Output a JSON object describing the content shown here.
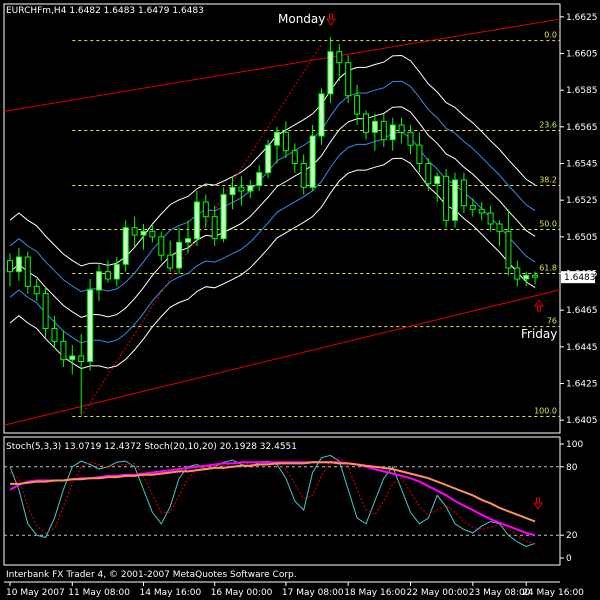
{
  "header": {
    "symbol": "EURCHFm,H4",
    "ohlc": "1.6482 1.6483 1.6479 1.6483"
  },
  "footer": {
    "copyright": "Interbank FX Trader 4, © 2001-2007 MetaQuotes Software Corp."
  },
  "colors": {
    "background": "#000000",
    "bull_candle": "#c8ffc8",
    "bear_candle": "#000000",
    "candle_outline": "#00ff00",
    "fib": "#e6e64a",
    "trend": "#e00000",
    "inner_band": "#2f8fe8",
    "outer_band": "#ffffff",
    "stoch_fast_main": "#4ac8c8",
    "stoch_fast_signal": "#e00000",
    "stoch_slow_main": "#ff00ff",
    "stoch_slow_signal": "#ff9060"
  },
  "chart_data": [
    {
      "type": "candlestick",
      "title": "",
      "price_axis": {
        "ylim": [
          1.6398,
          1.6632
        ],
        "ticks": [
          "1.6625",
          "1.6605",
          "1.6585",
          "1.6565",
          "1.6545",
          "1.6525",
          "1.6505",
          "1.6485",
          "1.6465",
          "1.6445",
          "1.6425",
          "1.6405"
        ],
        "current_price": "1.6483"
      },
      "time_axis": {
        "ticks": [
          "10 May 2007",
          "11 May 08:00",
          "14 May 16:00",
          "16 May 00:00",
          "17 May 08:00",
          "18 May 16:00",
          "22 May 00:00",
          "23 May 08:00",
          "24 May 16:00"
        ]
      },
      "candles": [
        [
          1.6492,
          1.6496,
          1.6478,
          1.6486
        ],
        [
          1.6486,
          1.6499,
          1.6481,
          1.6494
        ],
        [
          1.6494,
          1.6497,
          1.6474,
          1.6478
        ],
        [
          1.6478,
          1.6482,
          1.647,
          1.6474
        ],
        [
          1.6474,
          1.6478,
          1.645,
          1.6455
        ],
        [
          1.6455,
          1.6462,
          1.6444,
          1.6448
        ],
        [
          1.6448,
          1.6454,
          1.6434,
          1.6438
        ],
        [
          1.6438,
          1.6446,
          1.643,
          1.644
        ],
        [
          1.644,
          1.6452,
          1.6408,
          1.6437
        ],
        [
          1.6437,
          1.6482,
          1.6432,
          1.6476
        ],
        [
          1.6476,
          1.649,
          1.647,
          1.6486
        ],
        [
          1.6486,
          1.6492,
          1.648,
          1.6482
        ],
        [
          1.6482,
          1.6494,
          1.6478,
          1.649
        ],
        [
          1.649,
          1.6514,
          1.6486,
          1.651
        ],
        [
          1.651,
          1.6516,
          1.65,
          1.6506
        ],
        [
          1.6506,
          1.6512,
          1.6498,
          1.6508
        ],
        [
          1.6508,
          1.6512,
          1.6502,
          1.6505
        ],
        [
          1.6505,
          1.6508,
          1.6492,
          1.6495
        ],
        [
          1.6495,
          1.6503,
          1.6486,
          1.6488
        ],
        [
          1.6488,
          1.651,
          1.6485,
          1.6502
        ],
        [
          1.6502,
          1.6514,
          1.6496,
          1.6504
        ],
        [
          1.6504,
          1.653,
          1.65,
          1.6524
        ],
        [
          1.6524,
          1.6528,
          1.651,
          1.6516
        ],
        [
          1.6516,
          1.6522,
          1.65,
          1.6504
        ],
        [
          1.6504,
          1.6532,
          1.6502,
          1.6528
        ],
        [
          1.6528,
          1.6538,
          1.652,
          1.6532
        ],
        [
          1.6532,
          1.6538,
          1.6522,
          1.653
        ],
        [
          1.653,
          1.6536,
          1.6526,
          1.6533
        ],
        [
          1.6533,
          1.6544,
          1.653,
          1.654
        ],
        [
          1.654,
          1.6558,
          1.6537,
          1.6555
        ],
        [
          1.6555,
          1.6565,
          1.6545,
          1.6562
        ],
        [
          1.6562,
          1.6568,
          1.6548,
          1.6552
        ],
        [
          1.6552,
          1.6556,
          1.654,
          1.6545
        ],
        [
          1.6545,
          1.655,
          1.6528,
          1.6532
        ],
        [
          1.6532,
          1.6566,
          1.653,
          1.656
        ],
        [
          1.656,
          1.6586,
          1.6555,
          1.6583
        ],
        [
          1.6583,
          1.6614,
          1.6578,
          1.6606
        ],
        [
          1.6606,
          1.661,
          1.659,
          1.66
        ],
        [
          1.66,
          1.6604,
          1.6578,
          1.6582
        ],
        [
          1.6582,
          1.6588,
          1.6566,
          1.6572
        ],
        [
          1.6572,
          1.6574,
          1.6558,
          1.6562
        ],
        [
          1.6562,
          1.6572,
          1.6552,
          1.6568
        ],
        [
          1.6568,
          1.6572,
          1.6554,
          1.6558
        ],
        [
          1.6558,
          1.657,
          1.6552,
          1.6566
        ],
        [
          1.6566,
          1.657,
          1.6556,
          1.6562
        ],
        [
          1.6562,
          1.6566,
          1.655,
          1.6555
        ],
        [
          1.6555,
          1.6562,
          1.654,
          1.6545
        ],
        [
          1.6545,
          1.6548,
          1.653,
          1.6534
        ],
        [
          1.6534,
          1.654,
          1.6524,
          1.6538
        ],
        [
          1.6538,
          1.6542,
          1.651,
          1.6514
        ],
        [
          1.6514,
          1.654,
          1.651,
          1.6536
        ],
        [
          1.6536,
          1.654,
          1.6518,
          1.6522
        ],
        [
          1.6522,
          1.6526,
          1.6516,
          1.652
        ],
        [
          1.652,
          1.6524,
          1.6514,
          1.6518
        ],
        [
          1.6518,
          1.6522,
          1.6508,
          1.6512
        ],
        [
          1.6512,
          1.6514,
          1.65,
          1.6508
        ],
        [
          1.6508,
          1.652,
          1.6484,
          1.6488
        ],
        [
          1.6488,
          1.6492,
          1.6478,
          1.6482
        ],
        [
          1.6482,
          1.6486,
          1.6478,
          1.6484
        ],
        [
          1.6484,
          1.6486,
          1.6479,
          1.6483
        ]
      ],
      "overlays": {
        "fibonacci": [
          {
            "label": "0.0",
            "price": 1.6612
          },
          {
            "label": "23.6",
            "price": 1.6563
          },
          {
            "label": "38.2",
            "price": 1.6533
          },
          {
            "label": "50.0",
            "price": 1.6509
          },
          {
            "label": "61.8",
            "price": 1.6485
          },
          {
            "label": "76",
            "price": 1.6456
          },
          {
            "label": "100.0",
            "price": 1.6407
          }
        ],
        "upper_trendline": {
          "from": [
            0,
            1.6574
          ],
          "to": [
            72,
            1.6632
          ]
        },
        "lower_trendline": {
          "from": [
            0,
            1.6403
          ],
          "to": [
            60,
            1.6474
          ]
        },
        "dotted_trendline": {
          "from": [
            8,
            1.6407
          ],
          "to": [
            35,
            1.661
          ]
        }
      },
      "annotations": [
        {
          "text": "Monday",
          "marker": "down-arrow"
        },
        {
          "text": "Friday",
          "marker": "up-arrow"
        }
      ]
    },
    {
      "type": "line",
      "title": "",
      "indicator_header": "Stoch(5,3,3) 13.0719 12.4372  Stoch(20,10,20) 20.1928 32.4551",
      "ylim": [
        0,
        100
      ],
      "yticks": [
        100,
        80,
        20,
        0
      ],
      "levels": [
        80,
        20
      ],
      "marker": "down-arrow",
      "series": [
        {
          "values": [
            80,
            60,
            30,
            20,
            18,
            35,
            60,
            80,
            85,
            82,
            78,
            80,
            84,
            85,
            80,
            60,
            40,
            30,
            45,
            70,
            80,
            82,
            78,
            80,
            84,
            86,
            82,
            80,
            84,
            85,
            82,
            70,
            50,
            42,
            75,
            88,
            90,
            85,
            60,
            35,
            30,
            50,
            70,
            80,
            60,
            40,
            30,
            35,
            55,
            45,
            30,
            25,
            22,
            28,
            32,
            30,
            20,
            14,
            10,
            13
          ]
        },
        {
          "values": [
            75,
            70,
            45,
            28,
            22,
            26,
            45,
            65,
            80,
            84,
            82,
            80,
            81,
            82,
            83,
            72,
            55,
            40,
            40,
            55,
            70,
            78,
            80,
            80,
            81,
            83,
            84,
            82,
            82,
            83,
            83,
            78,
            65,
            52,
            55,
            72,
            85,
            88,
            80,
            60,
            42,
            38,
            50,
            65,
            70,
            58,
            45,
            38,
            42,
            46,
            40,
            32,
            27,
            25,
            27,
            29,
            26,
            20,
            15,
            12
          ]
        },
        {
          "values": [
            60,
            64,
            67,
            68,
            68,
            68,
            68,
            69,
            70,
            70,
            71,
            72,
            72,
            73,
            73,
            74,
            75,
            76,
            77,
            78,
            79,
            80,
            81,
            82,
            83,
            83,
            84,
            84,
            84,
            84,
            84,
            84,
            84,
            84,
            84,
            84,
            84,
            84,
            83,
            82,
            80,
            78,
            76,
            74,
            72,
            70,
            67,
            63,
            59,
            55,
            50,
            46,
            42,
            38,
            34,
            31,
            28,
            25,
            22,
            20
          ]
        },
        {
          "values": [
            65,
            65,
            66,
            67,
            67,
            68,
            68,
            69,
            69,
            70,
            70,
            71,
            71,
            72,
            72,
            73,
            73,
            74,
            75,
            76,
            76,
            77,
            78,
            79,
            79,
            80,
            81,
            81,
            82,
            82,
            83,
            83,
            83,
            83,
            84,
            84,
            84,
            83,
            83,
            82,
            81,
            80,
            79,
            78,
            76,
            74,
            72,
            70,
            67,
            64,
            61,
            58,
            55,
            51,
            48,
            44,
            41,
            38,
            35,
            32
          ]
        }
      ]
    }
  ]
}
